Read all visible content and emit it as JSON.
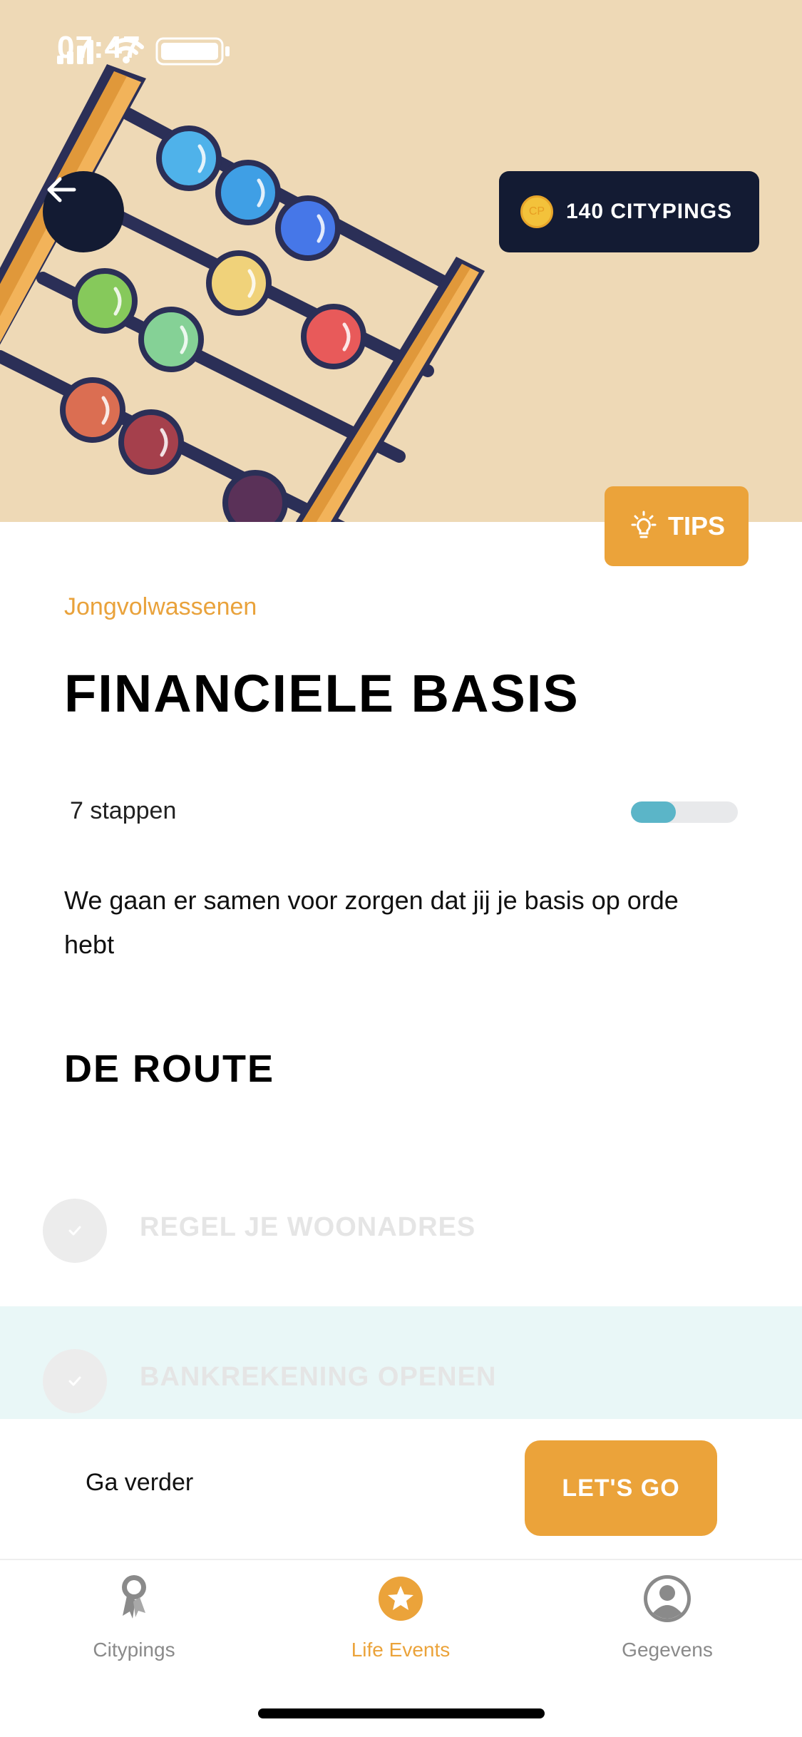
{
  "status_bar": {
    "time": "07:47"
  },
  "header": {
    "coin_symbol": "CP",
    "coins_label": "140 CITYPINGS",
    "tips_label": "TIPS"
  },
  "content": {
    "category": "Jongvolwassenen",
    "title": "FINANCIELE BASIS",
    "steps_label": "7 stappen",
    "progress_fraction": 0.42,
    "description": "We gaan er samen voor zorgen dat jij je basis op orde hebt",
    "route_title": "DE ROUTE",
    "route_items": [
      {
        "label": "REGEL JE WOONADRES"
      },
      {
        "label": "BANKREKENING OPENEN"
      }
    ]
  },
  "action_bar": {
    "continue_label": "Ga verder",
    "go_label": "LET'S GO"
  },
  "tabbar": {
    "tabs": [
      {
        "label": "Citypings",
        "icon": "award-icon"
      },
      {
        "label": "Life Events",
        "icon": "star-icon"
      },
      {
        "label": "Gegevens",
        "icon": "user-icon"
      }
    ],
    "active_tab": "Life Events"
  },
  "colors": {
    "accent": "#eba33a",
    "hero_bg": "#eed9b6",
    "dark": "#131b33",
    "progress": "#5bb5c8"
  }
}
